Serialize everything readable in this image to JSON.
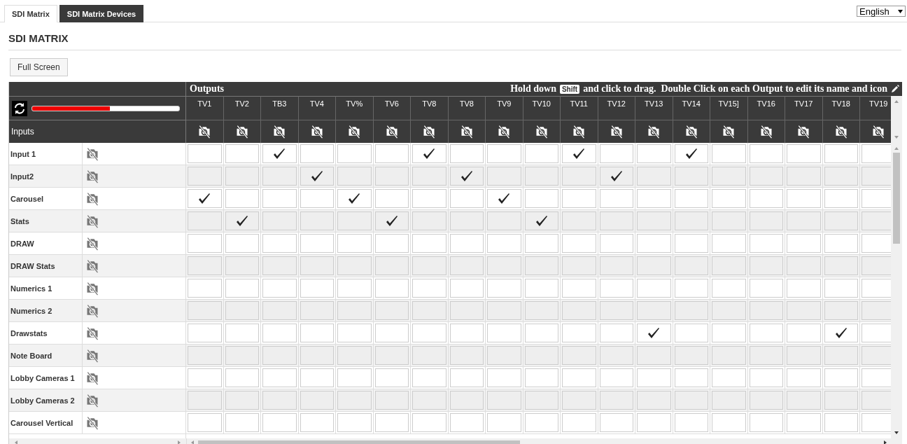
{
  "tabs": [
    {
      "label": "SDI Matrix",
      "selected": true
    },
    {
      "label": "SDI Matrix Devices",
      "selected": false
    }
  ],
  "language": "English",
  "title": "SDI MATRIX",
  "full_screen_button": "Full Screen",
  "matrix": {
    "outputs_label": "Outputs",
    "hint_before": "Hold down",
    "hint_key": "Shift",
    "hint_after": "and click to drag.  Double Click on each Output to edit its name and icon",
    "progress": {
      "level": 0.53
    },
    "inputs_label": "Inputs",
    "outputs": [
      {
        "name": "TV1"
      },
      {
        "name": "TV2"
      },
      {
        "name": "TB3"
      },
      {
        "name": "TV4"
      },
      {
        "name": "TV%"
      },
      {
        "name": "TV6"
      },
      {
        "name": "TV8"
      },
      {
        "name": "TV8"
      },
      {
        "name": "TV9"
      },
      {
        "name": "TV10"
      },
      {
        "name": "TV11"
      },
      {
        "name": "TV12"
      },
      {
        "name": "TV13"
      },
      {
        "name": "TV14"
      },
      {
        "name": "TV15]"
      },
      {
        "name": "TV16"
      },
      {
        "name": "TV17"
      },
      {
        "name": "TV18"
      },
      {
        "name": "TV19"
      }
    ],
    "rows": [
      {
        "name": "Input 1",
        "checked": [
          false,
          false,
          true,
          false,
          false,
          false,
          true,
          false,
          false,
          false,
          true,
          false,
          false,
          true,
          false,
          false,
          false,
          false,
          false
        ]
      },
      {
        "name": "Input2",
        "checked": [
          false,
          false,
          false,
          true,
          false,
          false,
          false,
          true,
          false,
          false,
          false,
          true,
          false,
          false,
          false,
          false,
          false,
          false,
          false
        ]
      },
      {
        "name": "Carousel",
        "checked": [
          true,
          false,
          false,
          false,
          true,
          false,
          false,
          false,
          true,
          false,
          false,
          false,
          false,
          false,
          false,
          false,
          false,
          false,
          false
        ]
      },
      {
        "name": "Stats",
        "checked": [
          false,
          true,
          false,
          false,
          false,
          true,
          false,
          false,
          false,
          true,
          false,
          false,
          false,
          false,
          false,
          false,
          false,
          false,
          false
        ]
      },
      {
        "name": "DRAW",
        "checked": [
          false,
          false,
          false,
          false,
          false,
          false,
          false,
          false,
          false,
          false,
          false,
          false,
          false,
          false,
          false,
          false,
          false,
          false,
          false
        ]
      },
      {
        "name": "DRAW Stats",
        "checked": [
          false,
          false,
          false,
          false,
          false,
          false,
          false,
          false,
          false,
          false,
          false,
          false,
          false,
          false,
          false,
          false,
          false,
          false,
          false
        ]
      },
      {
        "name": "Numerics 1",
        "checked": [
          false,
          false,
          false,
          false,
          false,
          false,
          false,
          false,
          false,
          false,
          false,
          false,
          false,
          false,
          false,
          false,
          false,
          false,
          false
        ]
      },
      {
        "name": "Numerics 2",
        "checked": [
          false,
          false,
          false,
          false,
          false,
          false,
          false,
          false,
          false,
          false,
          false,
          false,
          false,
          false,
          false,
          false,
          false,
          false,
          false
        ]
      },
      {
        "name": "Drawstats",
        "checked": [
          false,
          false,
          false,
          false,
          false,
          false,
          false,
          false,
          false,
          false,
          false,
          false,
          true,
          false,
          false,
          false,
          false,
          true,
          false
        ]
      },
      {
        "name": "Note Board",
        "checked": [
          false,
          false,
          false,
          false,
          false,
          false,
          false,
          false,
          false,
          false,
          false,
          false,
          false,
          false,
          false,
          false,
          false,
          false,
          false
        ]
      },
      {
        "name": "Lobby Cameras 1",
        "checked": [
          false,
          false,
          false,
          false,
          false,
          false,
          false,
          false,
          false,
          false,
          false,
          false,
          false,
          false,
          false,
          false,
          false,
          false,
          false
        ]
      },
      {
        "name": "Lobby Cameras 2",
        "checked": [
          false,
          false,
          false,
          false,
          false,
          false,
          false,
          false,
          false,
          false,
          false,
          false,
          false,
          false,
          false,
          false,
          false,
          false,
          false
        ]
      },
      {
        "name": "Carousel Vertical",
        "checked": [
          false,
          false,
          false,
          false,
          false,
          false,
          false,
          false,
          false,
          false,
          false,
          false,
          false,
          false,
          false,
          false,
          false,
          false,
          false
        ]
      }
    ]
  }
}
